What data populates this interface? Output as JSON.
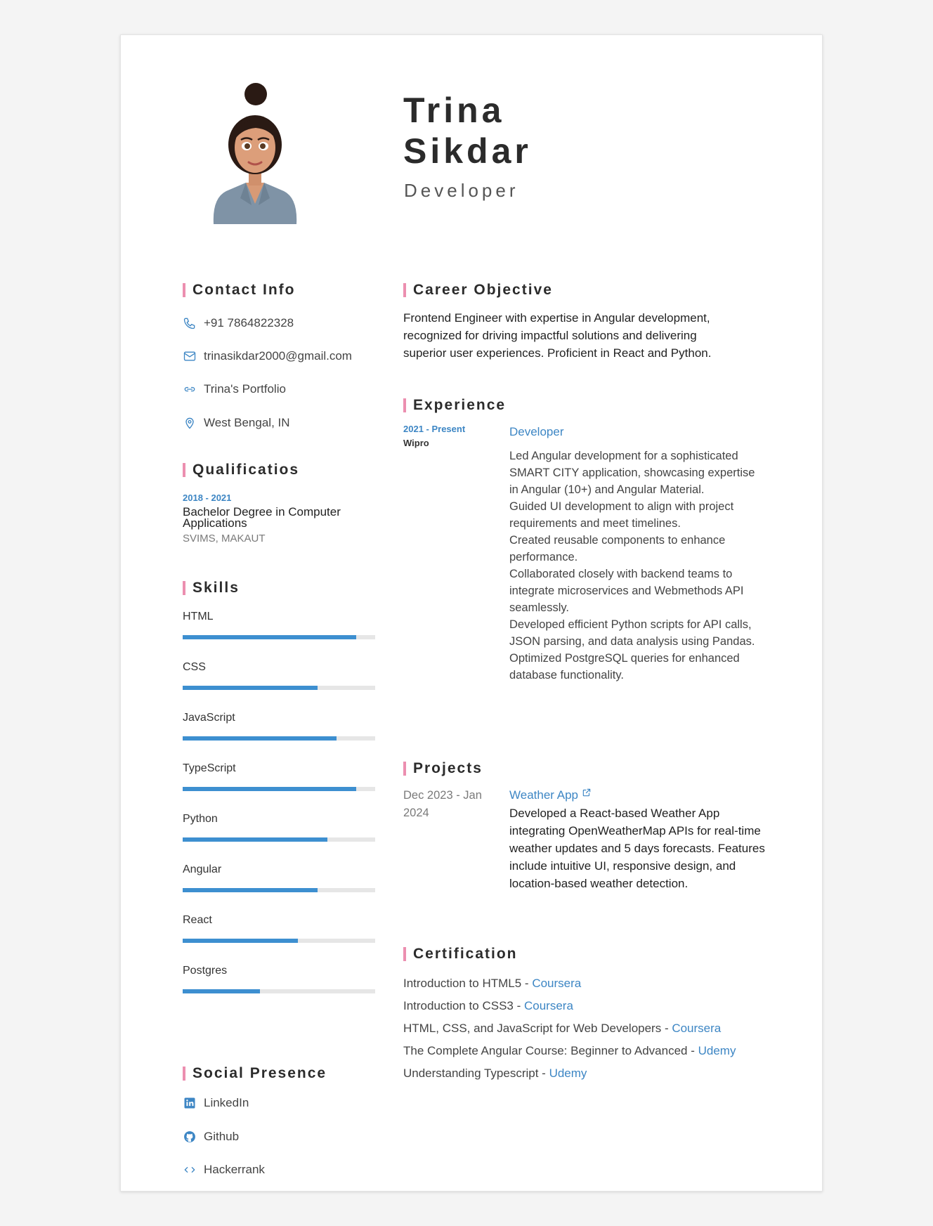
{
  "header": {
    "first_name": "Trina",
    "last_name": "Sikdar",
    "role": "Developer"
  },
  "headings": {
    "contact": "Contact Info",
    "qualifications": "Qualificatios",
    "skills": "Skills",
    "social": "Social Presence",
    "objective": "Career Objective",
    "experience": "Experience",
    "projects": "Projects",
    "certification": "Certification"
  },
  "contact": {
    "phone": "+91 7864822328",
    "email": "trinasikdar2000@gmail.com",
    "portfolio": "Trina's Portfolio",
    "location": "West Bengal, IN"
  },
  "qualification": {
    "years": "2018 - 2021",
    "degree": "Bachelor Degree in Computer Applications",
    "school": "SVIMS, MAKAUT"
  },
  "skills": [
    {
      "name": "HTML",
      "level": 0.9
    },
    {
      "name": "CSS",
      "level": 0.7
    },
    {
      "name": "JavaScript",
      "level": 0.8
    },
    {
      "name": "TypeScript",
      "level": 0.9
    },
    {
      "name": "Python",
      "level": 0.75
    },
    {
      "name": "Angular",
      "level": 0.7
    },
    {
      "name": "React",
      "level": 0.6
    },
    {
      "name": "Postgres",
      "level": 0.4
    }
  ],
  "social": {
    "linkedin": "LinkedIn",
    "github": "Github",
    "hackerrank": "Hackerrank"
  },
  "objective": "Frontend Engineer with expertise in Angular development, recognized for driving impactful solutions and delivering superior user experiences. Proficient in React and Python.",
  "experience": {
    "years": "2021 - Present",
    "company": "Wipro",
    "title": "Developer",
    "bullets": [
      "Led Angular development for a sophisticated SMART CITY application, showcasing expertise in Angular (10+) and Angular Material.",
      "Guided UI development to align with project requirements and meet timelines.",
      "Created reusable components to enhance performance.",
      "Collaborated closely with backend teams to integrate microservices and Webmethods API seamlessly.",
      "Developed efficient Python scripts for API calls, JSON parsing, and data analysis using Pandas.",
      "Optimized PostgreSQL queries for enhanced database functionality."
    ]
  },
  "project": {
    "dates": "Dec 2023 - Jan 2024",
    "title": "Weather App",
    "description": "Developed a React-based Weather App integrating OpenWeatherMap APIs for real-time weather updates and 5 days forecasts. Features include intuitive UI, responsive design, and location-based weather detection."
  },
  "certifications": [
    {
      "course": "Introduction to HTML5 - ",
      "provider": "Coursera"
    },
    {
      "course": "Introduction to CSS3 - ",
      "provider": "Coursera"
    },
    {
      "course": "HTML, CSS, and JavaScript for Web Developers - ",
      "provider": "Coursera"
    },
    {
      "course": "The Complete Angular Course: Beginner to Advanced - ",
      "provider": "Udemy"
    },
    {
      "course": "Understanding Typescript - ",
      "provider": "Udemy"
    }
  ],
  "colors": {
    "accent": "#3d86c4",
    "heading_bar": "#ec8fb0",
    "skill_fill": "#3d8fd0",
    "skill_track": "#e6e6e6"
  }
}
